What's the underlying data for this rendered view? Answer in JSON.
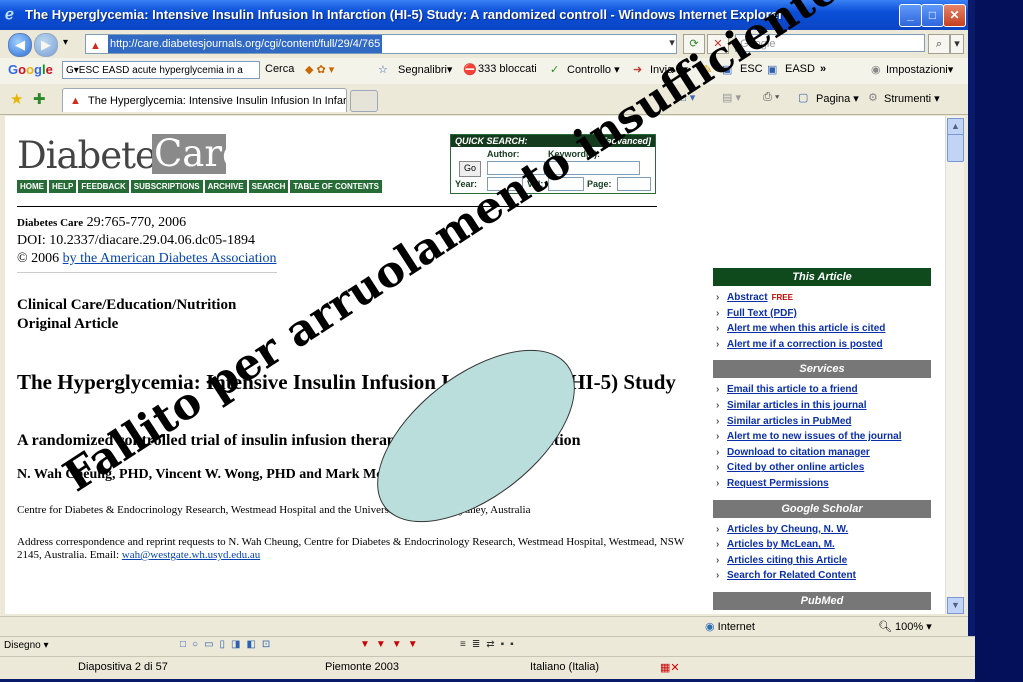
{
  "window": {
    "title": "The Hyperglycemia: Intensive Insulin Infusion In Infarction (HI-5) Study: A randomized controll - Windows Internet Explorer",
    "minimize": "_",
    "maximize": "□",
    "close": "✕"
  },
  "address": {
    "url": "http://care.diabetesjournals.org/cgi/content/full/29/4/765",
    "search_placeholder": "Google"
  },
  "google_toolbar": {
    "logo": "Google",
    "search_text": "G▾ESC EASD acute hyperglycemia in a",
    "items": [
      "Cerca",
      "Segnalibri▾",
      "333 bloccati",
      "Controllo ▾",
      "Invia a▾",
      "ESC",
      "EASD",
      "»",
      "Impostazioni▾"
    ]
  },
  "tabs_bar": {
    "tab_label": "The Hyperglycemia: Intensive Insulin Infusion In Infar...",
    "right_items": [
      "Pagina ▾",
      "Strumenti ▾"
    ]
  },
  "site": {
    "logo_a": "Diabetes",
    "logo_b": "Care",
    "nav": [
      "HOME",
      "HELP",
      "FEEDBACK",
      "SUBSCRIPTIONS",
      "ARCHIVE",
      "SEARCH",
      "TABLE OF CONTENTS"
    ],
    "quick_search": {
      "title": "QUICK SEARCH:",
      "advanced": "[advanced]",
      "author": "Author:",
      "keyword": "Keyword(s):",
      "go": "Go",
      "year": "Year:",
      "vol": "Vol:",
      "page": "Page:"
    }
  },
  "article": {
    "journal": "Diabetes Care",
    "citation": " 29:765-770, 2006",
    "doi": "DOI: 10.2337/diacare.29.04.06.dc05-1894",
    "copyright_prefix": "© 2006 ",
    "copyright_link": "by the American Diabetes Association",
    "section1": "Clinical Care/Education/Nutrition",
    "section2": "Original Article",
    "title": "The Hyperglycemia: Intensive Insulin Infusion In Infarction (HI-5) Study",
    "subtitle": "A randomized controlled trial of insulin infusion therapy for myocardial infarction",
    "authors": "N. Wah Cheung, PHD, Vincent W. Wong, PHD and Mark McLean, PHD",
    "affiliation": "Centre for Diabetes & Endocrinology Research, Westmead Hospital and the University of Sydney, Sydney, Australia",
    "correspondence": "Address correspondence and reprint requests to N. Wah Cheung, Centre for Diabetes & Endocrinology Research, Westmead Hospital, Westmead, NSW 2145, Australia. Email: ",
    "email": "wah@westgate.wh.usyd.edu.au"
  },
  "sidebar": {
    "this_article": {
      "header": "This Article",
      "items": [
        {
          "label": "Abstract",
          "badge": "FREE"
        },
        {
          "label": "Full Text (PDF)",
          "badge": ""
        },
        {
          "label": "Alert me when this article is cited",
          "badge": ""
        },
        {
          "label": "Alert me if a correction is posted",
          "badge": ""
        }
      ]
    },
    "services": {
      "header": "Services",
      "items": [
        "Email this article to a friend",
        "Similar articles in this journal",
        "Similar articles in PubMed",
        "Alert me to new issues of the journal",
        "Download to citation manager",
        "Cited by other online articles",
        "Request Permissions"
      ]
    },
    "scholar": {
      "header": "Google Scholar",
      "items": [
        "Articles by Cheung, N. W.",
        "Articles by McLean, M.",
        "Articles citing this Article",
        "Search for Related Content"
      ]
    },
    "pubmed": {
      "header": "PubMed"
    }
  },
  "statusbar": {
    "zone": "Internet",
    "zoom": "100%"
  },
  "ppt": {
    "draw": "Disegno ▾",
    "slide": "Diapositiva 2 di 57",
    "design": "Piemonte 2003",
    "language": "Italiano (Italia)"
  },
  "overlay_text": "Fallito per arruolamento insufficiente",
  "colors": {
    "site_green": "#276b36",
    "overlay_ellipse": "#b9dedb",
    "xp_blue": "#0a4fd8"
  }
}
